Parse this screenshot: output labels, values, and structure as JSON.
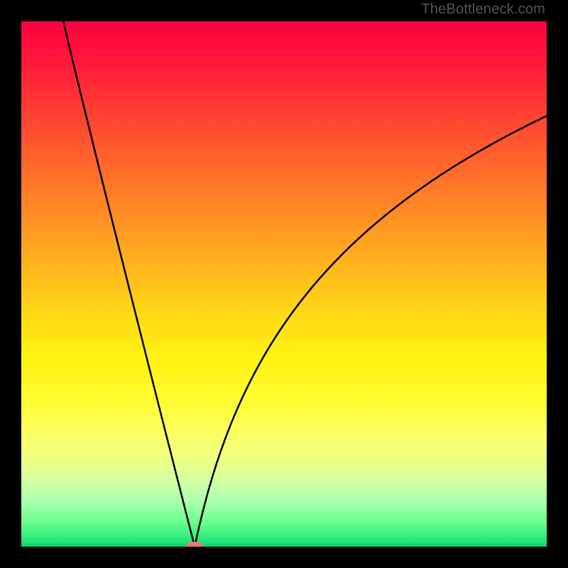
{
  "watermark": "TheBottleneck.com",
  "chart_data": {
    "type": "line",
    "title": "",
    "xlabel": "",
    "ylabel": "",
    "xlim": [
      0,
      100
    ],
    "ylim": [
      0,
      100
    ],
    "grid": false,
    "legend": false,
    "background_gradient": {
      "direction": "vertical",
      "stops": [
        {
          "pos": 0,
          "color": "#ff0040"
        },
        {
          "pos": 0.5,
          "color": "#ffcc18"
        },
        {
          "pos": 0.78,
          "color": "#fdff60"
        },
        {
          "pos": 0.95,
          "color": "#70ff90"
        },
        {
          "pos": 1.0,
          "color": "#10c868"
        }
      ]
    },
    "series": [
      {
        "name": "bottleneck-curve",
        "type": "line",
        "color": "#000000",
        "x_min_at": 33,
        "y_at_min": 0,
        "left_branch": {
          "x_start": 8,
          "y_start": 100,
          "x_end": 33,
          "y_end": 0,
          "shape": "near-linear"
        },
        "right_branch": {
          "x_start": 33,
          "y_start": 0,
          "x_end": 100,
          "y_end": 82,
          "shape": "concave-log-like"
        }
      }
    ],
    "marker": {
      "x": 33,
      "y": 0,
      "shape": "pill",
      "color": "#e87a7a"
    }
  },
  "colors": {
    "frame": "#000000",
    "curve": "#000000",
    "marker": "#e87a7a",
    "watermark": "#555555"
  }
}
